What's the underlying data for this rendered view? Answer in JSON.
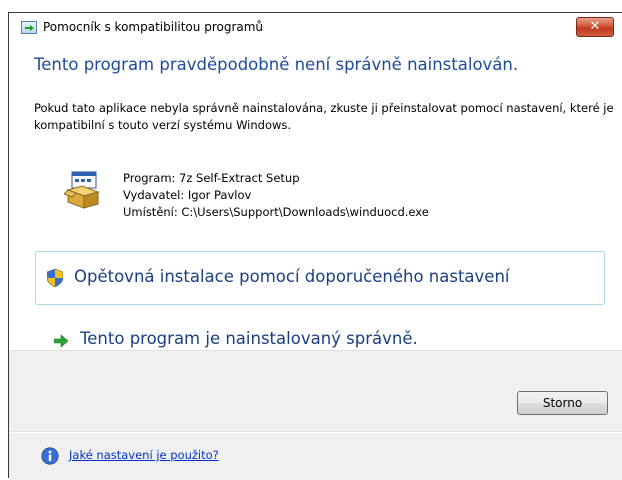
{
  "window": {
    "title": "Pomocník s kompatibilitou programů",
    "close_glyph": "✕"
  },
  "heading": "Tento program pravděpodobně není správně nainstalován.",
  "description": "Pokud tato aplikace nebyla správně nainstalována, zkuste ji přeinstalovat pomocí nastavení, které je kompatibilní s touto verzí systému Windows.",
  "program": {
    "name_line": "Program: 7z Self-Extract Setup",
    "publisher_line": "Vydavatel: Igor Pavlov",
    "location_line": "Umístění: C:\\Users\\Support\\Downloads\\winduocd.exe",
    "icon": "setup-installer-icon"
  },
  "options": {
    "reinstall_label": "Opětovná instalace pomocí doporučeného nastavení",
    "reinstall_icon": "uac-shield-icon",
    "installed_ok_label": "Tento program je nainstalovaný správně.",
    "installed_ok_icon": "green-arrow-icon"
  },
  "buttons": {
    "cancel_label": "Storno"
  },
  "footer": {
    "help_link": "Jaké nastavení je použito?",
    "help_icon": "info-icon"
  },
  "colors": {
    "heading": "#1e4b9c",
    "link": "#0033cc",
    "accent_border": "#a9dbe8"
  }
}
